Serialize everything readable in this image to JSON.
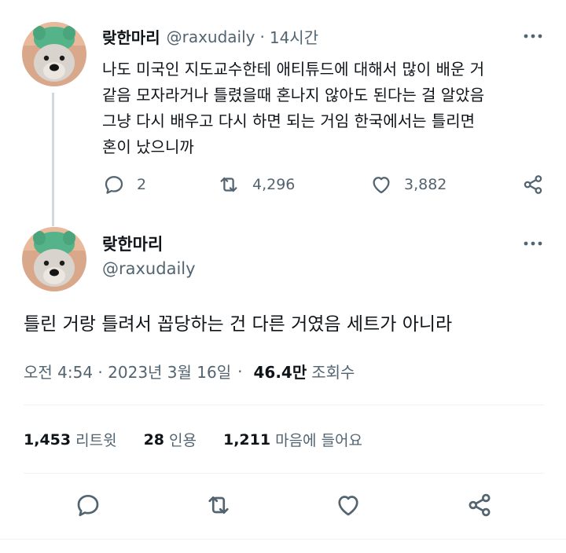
{
  "parent_tweet": {
    "display_name": "랒한마리",
    "handle": "@raxudaily",
    "separator": "·",
    "time": "14시간",
    "text_lines": [
      "나도 미국인 지도교수한테 애티튜드에 대해서 많이 배운 거",
      "같음 모자라거나 틀렸을때 혼나지 않아도 된다는 걸 알았음",
      "그냥 다시 배우고 다시 하면 되는 거임 한국에서는 틀리면",
      "혼이 났으니까"
    ],
    "reply_count": "2",
    "retweet_count": "4,296",
    "like_count": "3,882",
    "icons": {
      "reply": "reply-icon",
      "retweet": "retweet-icon",
      "like": "heart-icon",
      "share": "share-icon",
      "more": "more-icon"
    }
  },
  "main_tweet": {
    "display_name": "랒한마리",
    "handle": "@raxudaily",
    "text": "틀린 거랑 틀려서 꼽당하는 건 다른 거였음 세트가 아니라",
    "timestamp": "오전 4:54 · 2023년 3월 16일",
    "dot": "·",
    "views": "46.4만",
    "views_label": "조회수",
    "stats": {
      "retweets_count": "1,453",
      "retweets_label": "리트윗",
      "quotes_count": "28",
      "quotes_label": "인용",
      "likes_count": "1,211",
      "likes_label": "마음에 들어요"
    }
  },
  "colors": {
    "text_primary": "#0f1419",
    "text_secondary": "#536471",
    "thread_line": "#cfd9de",
    "divider": "#eff3f4"
  }
}
